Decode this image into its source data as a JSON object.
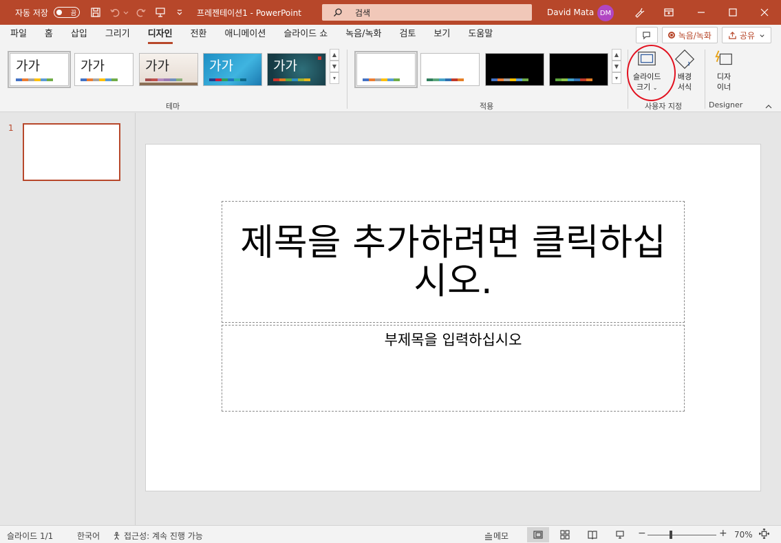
{
  "titlebar": {
    "autosave_label": "자동 저장",
    "autosave_state": "끔",
    "doc_title": "프레젠테이션1  -  PowerPoint",
    "search_placeholder": "검색",
    "user_name": "David Mata",
    "user_initials": "DM"
  },
  "menu": {
    "tabs": [
      "파일",
      "홈",
      "삽입",
      "그리기",
      "디자인",
      "전환",
      "애니메이션",
      "슬라이드 쇼",
      "녹음/녹화",
      "검토",
      "보기",
      "도움말"
    ],
    "active_tab": "디자인",
    "record_button": "녹음/녹화",
    "share_button": "공유"
  },
  "ribbon": {
    "themes": [
      {
        "label": "가가",
        "bg": "#ffffff",
        "text": "#262626"
      },
      {
        "label": "가가",
        "bg": "#ffffff",
        "text": "#262626"
      },
      {
        "label": "가가",
        "bg": "#efe9e4",
        "text": "#262626"
      },
      {
        "label": "가가",
        "bg": "#2e9fd0",
        "text": "#ffffff"
      },
      {
        "label": "가가",
        "bg": "#1d4f5a",
        "text": "#ffffff"
      }
    ],
    "theme_group_label": "테마",
    "variants_group_label": "적용",
    "slide_size_label_1": "슬라이드",
    "slide_size_label_2": "크기",
    "background_label_1": "배경",
    "background_label_2": "서식",
    "customize_group_label": "사용자 지정",
    "designer_label_1": "디자",
    "designer_label_2": "이너",
    "designer_group_label": "Designer"
  },
  "thumbnails": {
    "slide_number": "1"
  },
  "slide": {
    "title_placeholder": "제목을 추가하려면 클릭하십시오.",
    "subtitle_placeholder": "부제목을 입력하십시오"
  },
  "statusbar": {
    "slide_count": "슬라이드 1/1",
    "language": "한국어",
    "accessibility": "접근성: 계속 진행 가능",
    "notes": "메모",
    "zoom": "70%",
    "zoom_percent": 70
  },
  "colors": {
    "accent": "#b7472a",
    "highlight_circle": "#e2111f"
  }
}
